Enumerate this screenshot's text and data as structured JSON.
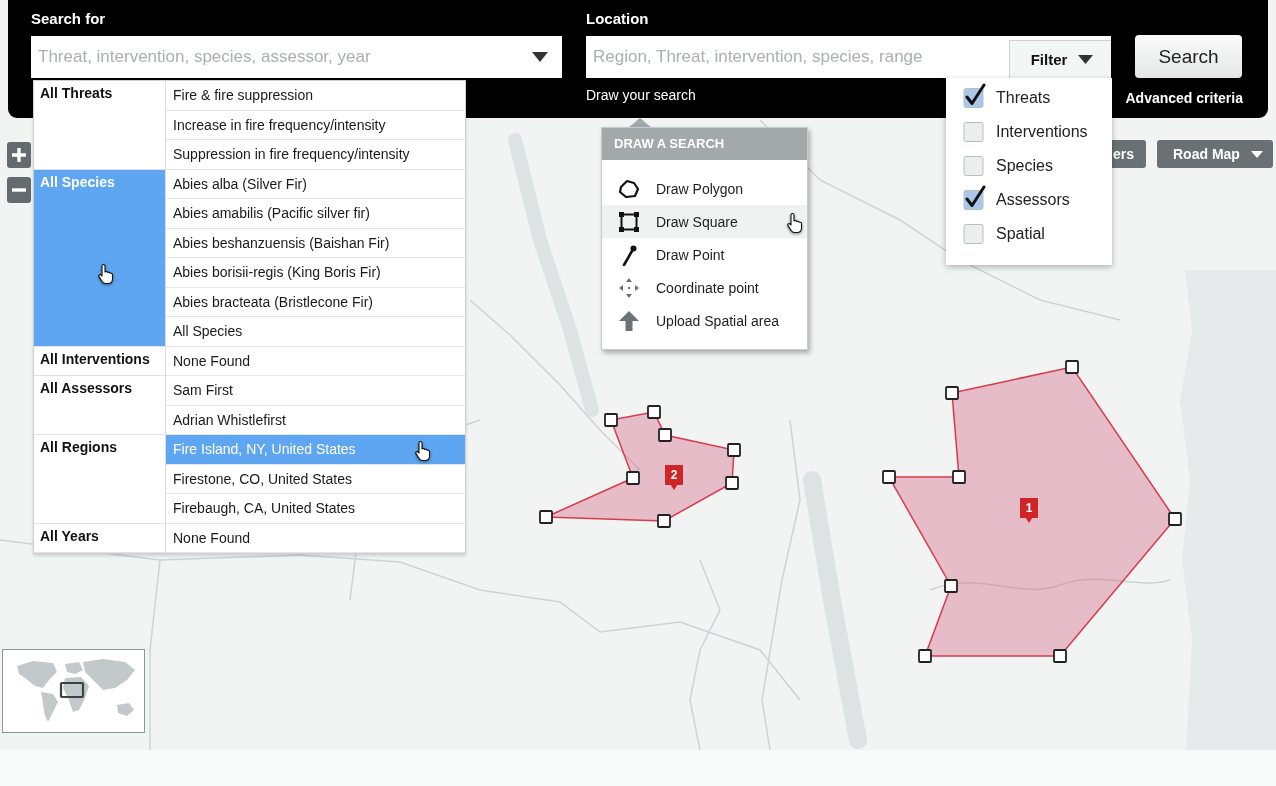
{
  "search_for": {
    "label": "Search for",
    "placeholder": "Threat, intervention, species, assessor, year"
  },
  "location": {
    "label": "Location",
    "placeholder": "Region, Threat, intervention, species, range",
    "filter_button": "Filter",
    "draw_link": "Draw your search"
  },
  "search_button": "Search",
  "advanced_link": "Advanced criteria",
  "results": [
    {
      "category": "All Threats",
      "selected": false,
      "items": [
        {
          "label": "Fire & fire suppression",
          "selected": false
        },
        {
          "label": "Increase in fire frequency/intensity",
          "selected": false
        },
        {
          "label": "Suppression in fire frequency/intensity",
          "selected": false
        }
      ]
    },
    {
      "category": "All Species",
      "selected": true,
      "items": [
        {
          "label": "Abies alba (Silver Fir)",
          "selected": false
        },
        {
          "label": "Abies amabilis (Pacific silver fir)",
          "selected": false
        },
        {
          "label": "Abies beshanzuensis (Baishan Fir)",
          "selected": false
        },
        {
          "label": "Abies borisii-regis (King Boris Fir)",
          "selected": false
        },
        {
          "label": "Abies bracteata (Bristlecone Fir)",
          "selected": false
        },
        {
          "label": "All Species",
          "selected": false
        }
      ]
    },
    {
      "category": "All Interventions",
      "selected": false,
      "items": [
        {
          "label": "None Found",
          "selected": false
        }
      ]
    },
    {
      "category": "All Assessors",
      "selected": false,
      "items": [
        {
          "label": "Sam First",
          "selected": false
        },
        {
          "label": "Adrian Whistlefirst",
          "selected": false
        }
      ]
    },
    {
      "category": "All Regions",
      "selected": false,
      "items": [
        {
          "label": "Fire Island, NY, United States",
          "selected": true
        },
        {
          "label": "Firestone, CO, United States",
          "selected": false
        },
        {
          "label": "Firebaugh, CA, United States",
          "selected": false
        }
      ]
    },
    {
      "category": "All Years",
      "selected": false,
      "items": [
        {
          "label": "None Found",
          "selected": false
        }
      ]
    }
  ],
  "draw_menu": {
    "title": "DRAW A SEARCH",
    "items": [
      {
        "kind": "polygon",
        "label": "Draw Polygon",
        "hovered": false
      },
      {
        "kind": "square",
        "label": "Draw Square",
        "hovered": true
      },
      {
        "kind": "point",
        "label": "Draw Point",
        "hovered": false
      },
      {
        "kind": "coordinate",
        "label": "Coordinate point",
        "hovered": false
      },
      {
        "kind": "upload",
        "label": "Upload Spatial area",
        "hovered": false
      }
    ]
  },
  "filter_menu": [
    {
      "label": "Threats",
      "checked": true
    },
    {
      "label": "Interventions",
      "checked": false
    },
    {
      "label": "Species",
      "checked": false
    },
    {
      "label": "Assessors",
      "checked": true
    },
    {
      "label": "Spatial",
      "checked": false
    }
  ],
  "map_controls": {
    "layers_button": "ers",
    "map_type_button": "Road Map"
  },
  "search_areas": [
    {
      "label": "2"
    },
    {
      "label": "1"
    }
  ]
}
